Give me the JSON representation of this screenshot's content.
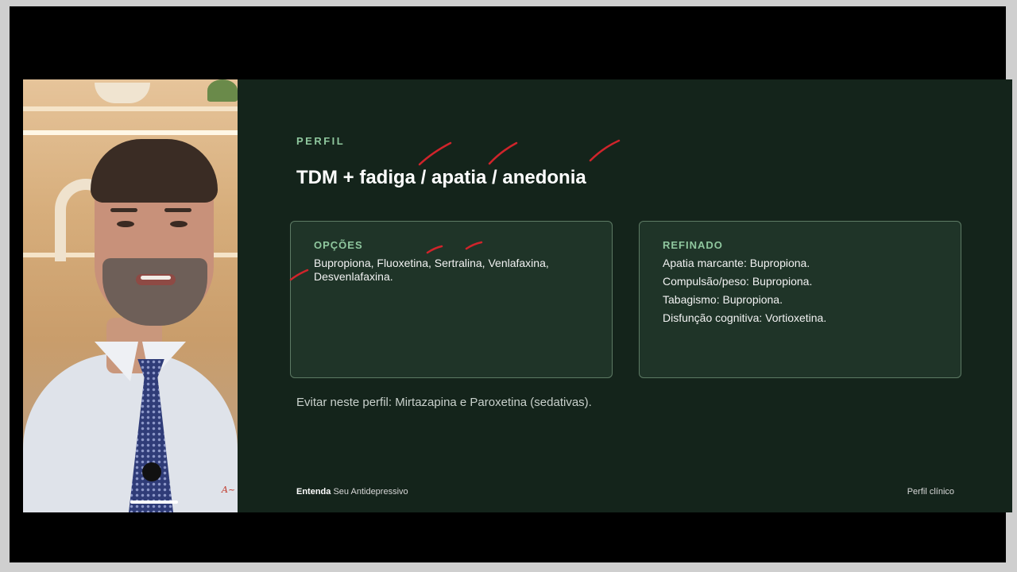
{
  "slide": {
    "eyebrow": "PERFIL",
    "title": "TDM + fadiga / apatia / anedonia",
    "card_options": {
      "heading": "OPÇÕES",
      "text": "Bupropiona, Fluoxetina, Sertralina, Venlafaxina, Desvenlafaxina."
    },
    "card_refined": {
      "heading": "REFINADO",
      "items": [
        "Apatia marcante: Bupropiona.",
        "Compulsão/peso: Bupropiona.",
        "Tabagismo: Bupropiona.",
        "Disfunção cognitiva: Vortioxetina."
      ]
    },
    "avoid_note": "Evitar neste perfil: Mirtazapina e Paroxetina (sedativas).",
    "footer": {
      "brand_bold": "Entenda",
      "brand_rest": "Seu Antidepressivo",
      "section": "Perfil clínico"
    }
  },
  "colors": {
    "slide_bg": "#14241b",
    "accent": "#8fc79e",
    "card_bg": "#1f3428",
    "annotation": "#d0242b"
  },
  "icons": [
    "signature-mark"
  ]
}
